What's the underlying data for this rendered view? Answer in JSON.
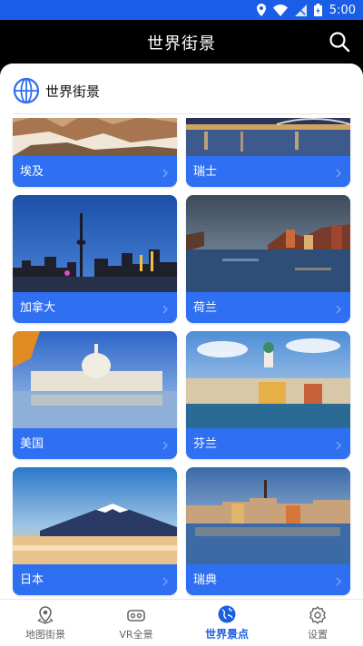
{
  "status": {
    "time": "5:00"
  },
  "header": {
    "title": "世界街景"
  },
  "section": {
    "title": "世界街景"
  },
  "cards": [
    {
      "name": "埃及",
      "scene": "desert"
    },
    {
      "name": "瑞士",
      "scene": "lake-night"
    },
    {
      "name": "加拿大",
      "scene": "skyline-night"
    },
    {
      "name": "荷兰",
      "scene": "canal"
    },
    {
      "name": "美国",
      "scene": "capitol"
    },
    {
      "name": "芬兰",
      "scene": "harbor"
    },
    {
      "name": "日本",
      "scene": "mountain"
    },
    {
      "name": "瑞典",
      "scene": "waterfront"
    }
  ],
  "tabs": [
    {
      "label": "地图街景",
      "icon": "map-pin-icon"
    },
    {
      "label": "VR全景",
      "icon": "vr-headset-icon"
    },
    {
      "label": "世界景点",
      "icon": "globe-icon",
      "active": true
    },
    {
      "label": "设置",
      "icon": "gear-icon"
    }
  ],
  "colors": {
    "accent": "#1b5fe0",
    "card": "#2f6ff2",
    "statusbar": "#1a5de6"
  }
}
